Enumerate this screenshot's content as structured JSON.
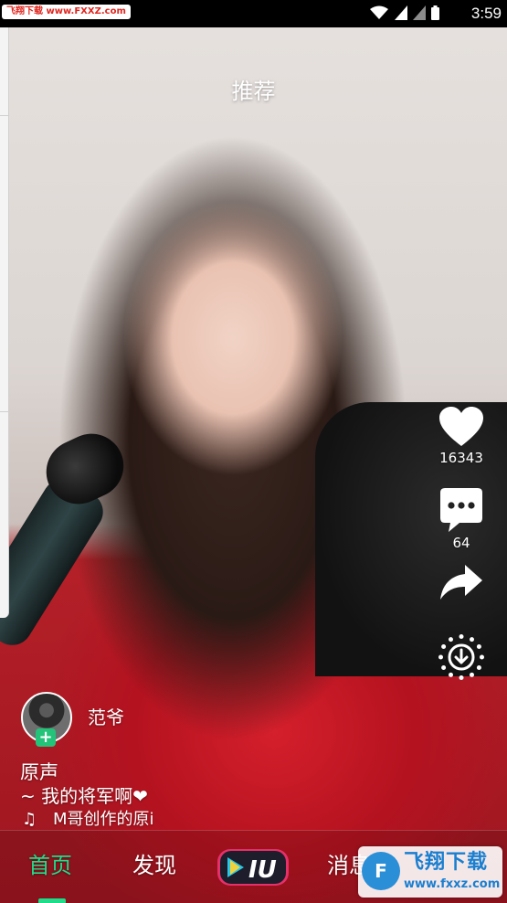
{
  "status_bar": {
    "watermark": "飞翔下载 www.FXXZ.com",
    "time": "3:59",
    "icons": [
      "wifi-icon",
      "signal-icon",
      "signal-icon",
      "battery-icon"
    ]
  },
  "header": {
    "title": "推荐"
  },
  "actions": {
    "like_icon": "heart-icon",
    "like_count": "16343",
    "comment_icon": "comment-icon",
    "comment_count": "64",
    "share_icon": "share-icon",
    "download_icon": "download-icon"
  },
  "author": {
    "name": "范爷",
    "follow_icon": "plus-icon"
  },
  "caption": {
    "title": "原声",
    "text": "~ 我的将军啊❤",
    "music_icon": "music-note-icon",
    "music_text": "M哥创作的原i"
  },
  "bottom_nav": {
    "tabs": [
      {
        "label": "首页",
        "active": true
      },
      {
        "label": "发现",
        "active": false
      },
      {
        "label": "消息",
        "active": false
      }
    ],
    "logo_text": "IU",
    "accent": "#1fdc8a"
  },
  "site_watermark": {
    "brand": "飞翔下载",
    "domain": "www.fxxz.com",
    "logo": "F"
  }
}
